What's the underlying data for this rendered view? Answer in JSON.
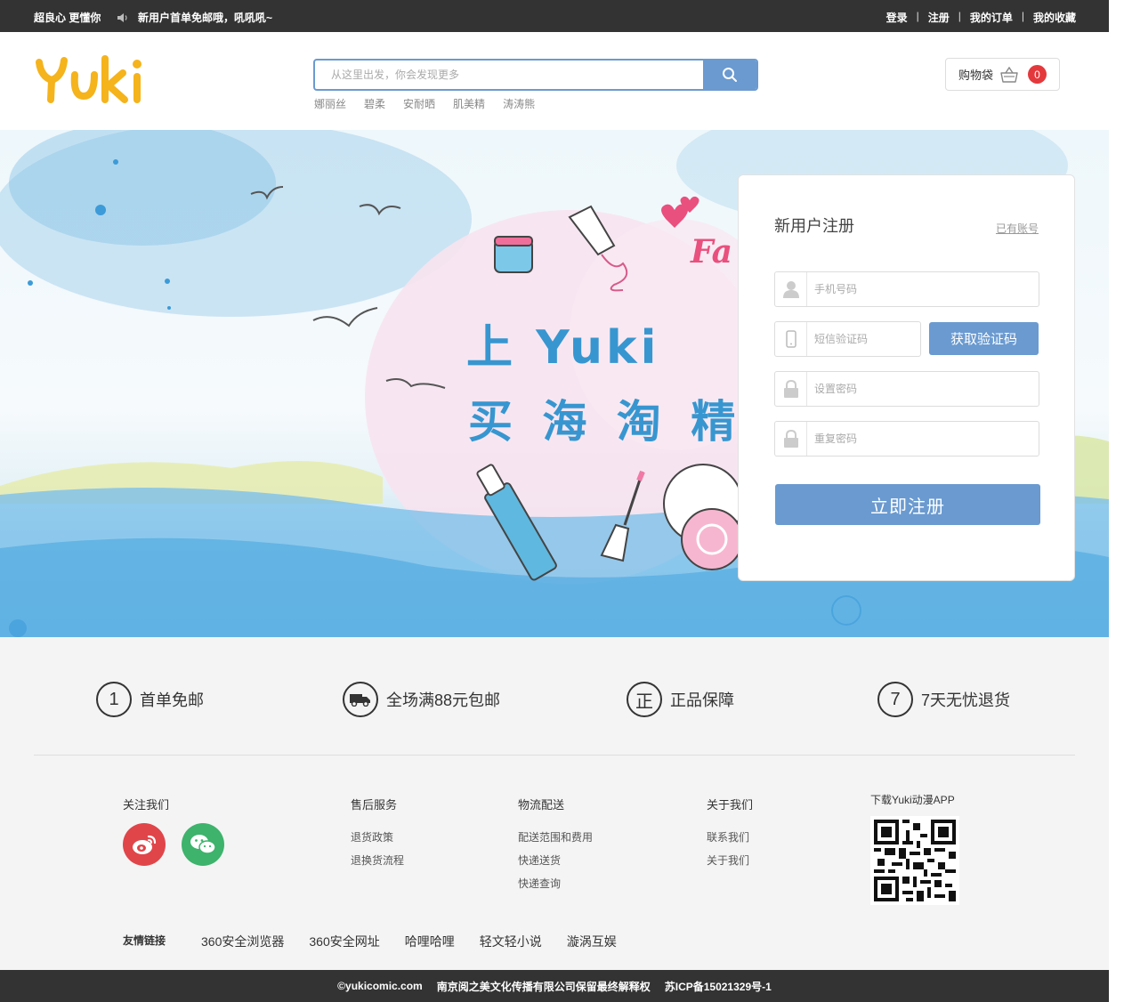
{
  "topbar": {
    "slogan": "超良心 更懂你",
    "notice": "新用户首单免邮哦，吼吼吼~",
    "links": [
      "登录",
      "注册",
      "我的订单",
      "我的收藏"
    ]
  },
  "header": {
    "logo_text": "Yuki",
    "search_placeholder": "从这里出发，你会发现更多",
    "hot_words": [
      "娜丽丝",
      "碧柔",
      "安耐晒",
      "肌美精",
      "涛涛熊"
    ],
    "cart_label": "购物袋",
    "cart_count": "0"
  },
  "banner": {
    "line1": "上 Yuki",
    "line2": "买 海 淘 精",
    "corner_text": "Fa"
  },
  "register": {
    "title": "新用户注册",
    "login_link": "已有账号",
    "phone_placeholder": "手机号码",
    "sms_placeholder": "短信验证码",
    "sms_button": "获取验证码",
    "password_placeholder": "设置密码",
    "repeat_password_placeholder": "重复密码",
    "submit": "立即注册"
  },
  "promises": [
    {
      "icon_text": "1",
      "label": "首单免邮"
    },
    {
      "icon_text": "",
      "label": "全场满88元包邮"
    },
    {
      "icon_text": "正",
      "label": "正品保障"
    },
    {
      "icon_text": "7",
      "label": "7天无忧退货"
    }
  ],
  "footer": {
    "follow_title": "关注我们",
    "after_sales": {
      "title": "售后服务",
      "items": [
        "退货政策",
        "退换货流程"
      ]
    },
    "logistics": {
      "title": "物流配送",
      "items": [
        "配送范围和费用",
        "快递送货",
        "快递查询"
      ]
    },
    "about": {
      "title": "关于我们",
      "items": [
        "联系我们",
        "关于我们"
      ]
    },
    "app_title": "下载Yuki动漫APP",
    "friend_links_title": "友情链接",
    "friend_links": [
      "360安全浏览器",
      "360安全网址",
      "哈哩哈哩",
      "轻文轻小说",
      "漩涡互娱"
    ]
  },
  "bottombar": {
    "copyright": "©yukicomic.com",
    "company": "南京阅之美文化传播有限公司保留最终解释权",
    "icp": "苏ICP备15021329号-1"
  },
  "colors": {
    "accent": "#6a9ad0",
    "badge": "#e4393c",
    "topbar": "#333333",
    "weibo": "#e0454a",
    "wechat": "#3db36c",
    "logo": "#f5b31c"
  }
}
